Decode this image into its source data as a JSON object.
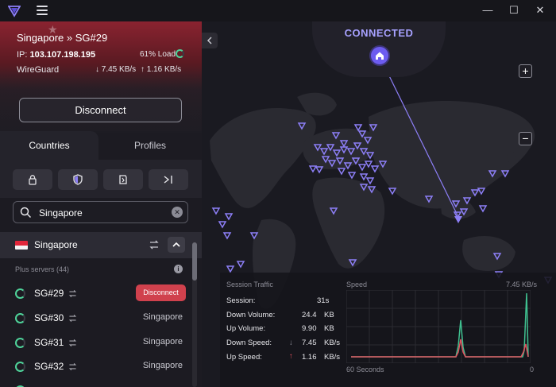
{
  "titlebar": {
    "logo_icon": "vpn-logo",
    "menu_icon": "hamburger-icon",
    "window_controls": [
      "minimize",
      "maximize",
      "close"
    ]
  },
  "connection": {
    "server_title": "Singapore » SG#29",
    "ip_label": "IP:",
    "ip_value": "103.107.198.195",
    "load": "61% Load",
    "load_fraction": 0.61,
    "protocol": "WireGuard",
    "download_speed": "7.45 KB/s",
    "upload_speed": "1.16 KB/s",
    "disconnect_label": "Disconnect"
  },
  "tabs": [
    "Countries",
    "Profiles"
  ],
  "filters": [
    "lock-icon",
    "shield-icon",
    "document-icon",
    "arrow-bar-icon"
  ],
  "search": {
    "value": "Singapore"
  },
  "country": {
    "name": "Singapore",
    "subheading": "Plus servers (44)"
  },
  "servers": [
    {
      "name": "SG#29",
      "location": "",
      "action": "Disconnect",
      "active": true
    },
    {
      "name": "SG#30",
      "location": "Singapore"
    },
    {
      "name": "SG#31",
      "location": "Singapore"
    },
    {
      "name": "SG#32",
      "location": "Singapore"
    }
  ],
  "map": {
    "status": "CONNECTED",
    "zoom_in": "+",
    "zoom_out": "−",
    "accent": "#7b6ef5"
  },
  "session": {
    "title": "Session Traffic",
    "rows": [
      {
        "label": "Session:",
        "value": "31s",
        "unit": ""
      },
      {
        "label": "Down Volume:",
        "value": "24.4",
        "unit": "KB"
      },
      {
        "label": "Up Volume:",
        "value": "9.90",
        "unit": "KB"
      },
      {
        "label": "Down Speed:",
        "value": "7.45",
        "unit": "KB/s"
      },
      {
        "label": "Up Speed:",
        "value": "1.16",
        "unit": "KB/s"
      }
    ]
  },
  "speed_chart": {
    "title": "Speed",
    "max_label": "7.45 KB/s",
    "x_start_label": "60 Seconds",
    "x_end_label": "0"
  }
}
